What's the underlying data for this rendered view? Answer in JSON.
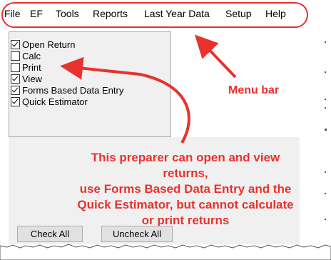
{
  "menu": {
    "items": [
      {
        "label": "File"
      },
      {
        "label": "EF"
      },
      {
        "label": "Tools"
      },
      {
        "label": "Reports"
      },
      {
        "label": "Last Year Data"
      },
      {
        "label": "Setup"
      },
      {
        "label": "Help"
      }
    ]
  },
  "permissions": [
    {
      "label": "Open Return",
      "checked": true
    },
    {
      "label": "Calc",
      "checked": false
    },
    {
      "label": "Print",
      "checked": false
    },
    {
      "label": "View",
      "checked": true
    },
    {
      "label": "Forms Based Data Entry",
      "checked": true
    },
    {
      "label": "Quick Estimator",
      "checked": true
    }
  ],
  "buttons": {
    "check_all": "Check All",
    "uncheck_all": "Uncheck All"
  },
  "annotations": {
    "menu_bar": "Menu bar",
    "description_lines": [
      "This preparer can open and view returns,",
      "use Forms Based Data Entry and the",
      "Quick Estimator, but cannot calculate",
      "or print returns"
    ]
  },
  "colors": {
    "annotation": "#e8322e",
    "panel_bg": "#f0f0f0",
    "button_bg": "#e1e1e1"
  }
}
